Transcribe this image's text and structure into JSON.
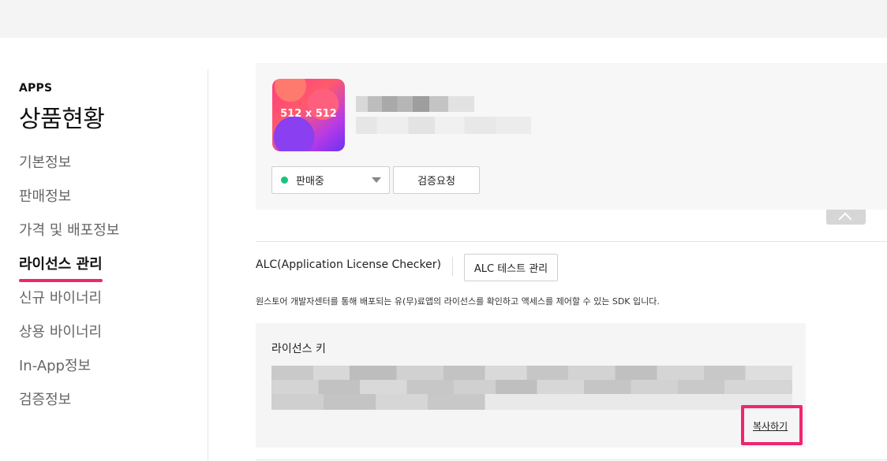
{
  "sidebar": {
    "kicker": "APPS",
    "title": "상품현황",
    "items": [
      {
        "label": "기본정보"
      },
      {
        "label": "판매정보"
      },
      {
        "label": "가격 및 배포정보"
      },
      {
        "label": "라이선스 관리"
      },
      {
        "label": "신규 바이너리"
      },
      {
        "label": "상용 바이너리"
      },
      {
        "label": "In-App정보"
      },
      {
        "label": "검증정보"
      }
    ],
    "active_index": 3
  },
  "app": {
    "icon_label": "512 x 512",
    "status_value": "판매중",
    "verify_label": "검증요청"
  },
  "alc": {
    "title": "ALC(Application License Checker)",
    "test_button": "ALC 테스트 관리",
    "description": "원스토어 개발자센터를 통해 배포되는 유(무)료앱의 라이선스를 확인하고 액세스를 제어할 수 있는 SDK 입니다."
  },
  "license": {
    "label": "라이선스 키",
    "copy_label": "복사하기"
  },
  "colors": {
    "accent": "#f0256f",
    "status_green": "#19c37d"
  }
}
